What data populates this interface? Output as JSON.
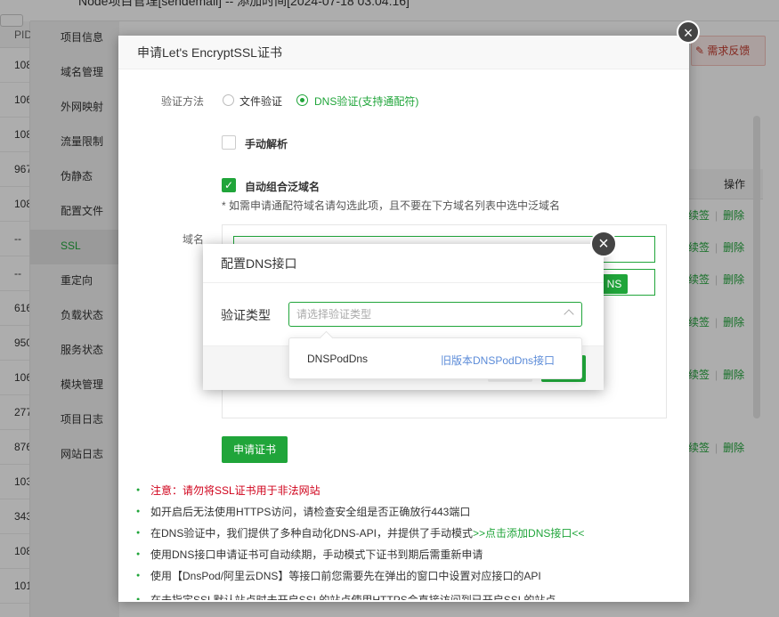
{
  "background": {
    "title": "Node项目管理[sendemail] -- 添加时间[2024-07-18 03:04:16]",
    "pid_header": "PID",
    "pid_values": [
      "108",
      "106",
      "108",
      "967",
      "108",
      "--",
      "--",
      "616",
      "950",
      "106",
      "277",
      "876",
      "103",
      "343",
      "108",
      "101"
    ],
    "nav_items": [
      "项目信息",
      "域名管理",
      "外网映射",
      "流量限制",
      "伪静态",
      "配置文件",
      "SSL",
      "重定向",
      "负载状态",
      "服务状态",
      "模块管理",
      "项目日志",
      "网站日志"
    ],
    "active_nav": "SSL",
    "feedback_label": "需求反馈",
    "op_header": "操作",
    "op_link_a": "续签",
    "op_link_b": "删除"
  },
  "ssl_dialog": {
    "title": "申请Let's EncryptSSL证书",
    "verify_method_label": "验证方法",
    "option_file": "文件验证",
    "option_dns": "DNS验证(支持通配符)",
    "manual_parse": "手动解析",
    "auto_wildcard": "自动组合泛域名",
    "wildcard_hint": "* 如需申请通配符域名请勾选此项，且不要在下方域名列表中选中泛域名",
    "domain_label": "域名",
    "dns_mini_btn": "NS",
    "apply_button": "申请证书",
    "notes": [
      "注意：请勿将SSL证书用于非法网站",
      "如开启后无法使用HTTPS访问，请检查安全组是否正确放行443端口",
      "在DNS验证中，我们提供了多种自动化DNS-API，并提供了手动模式",
      ">>点击添加DNS接口<<",
      "使用DNS接口申请证书可自动续期，手动模式下证书到期后需重新申请",
      "使用【DnsPod/阿里云DNS】等接口前您需要先在弹出的窗口中设置对应接口的API",
      "在未指定SSL默认站点时未开启SSL的站点使用HTTPS会直接访问到已开启SSL的站点"
    ]
  },
  "dns_dialog": {
    "title": "配置DNS接口",
    "verify_type_label": "验证类型",
    "select_placeholder": "请选择验证类型",
    "options": [
      {
        "name": "DNSPodDns",
        "desc": "旧版本DNSPodDns接口"
      }
    ]
  }
}
